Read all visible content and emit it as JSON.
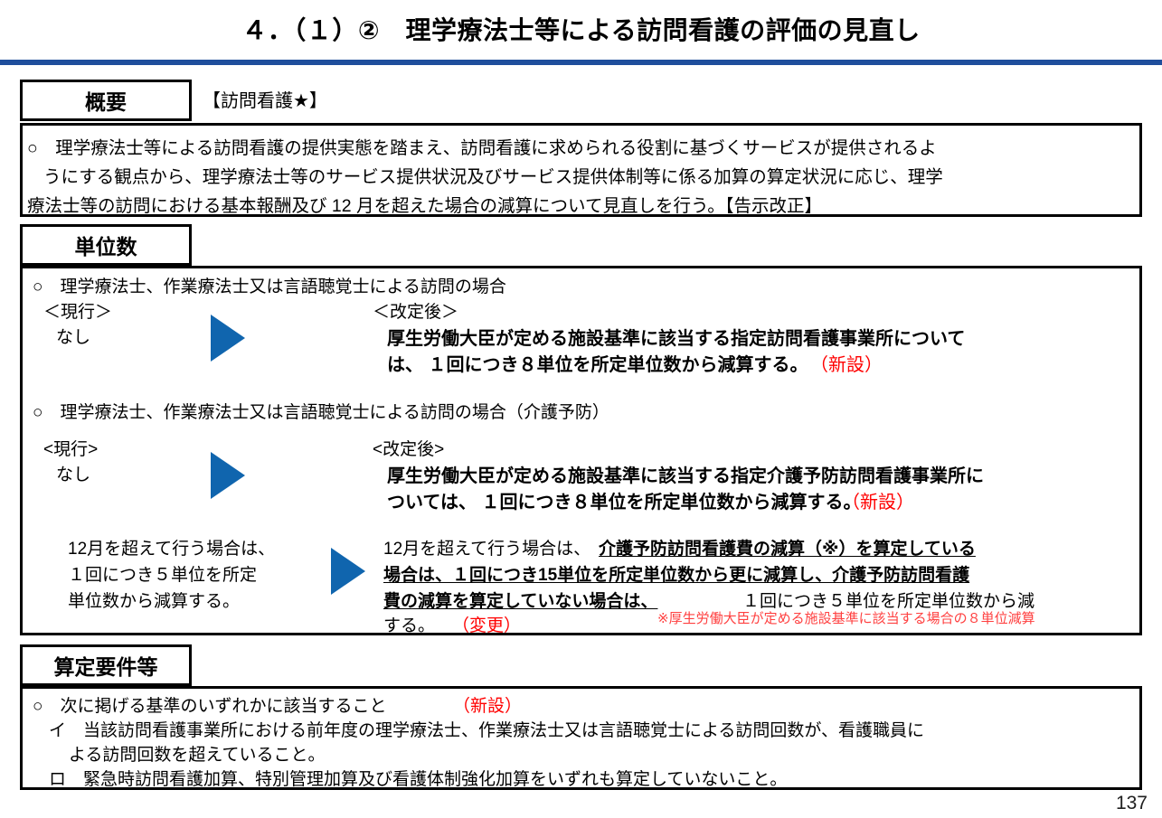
{
  "page": {
    "title": "４．（１）②　理学療法士等による訪問看護の評価の見直し",
    "page_number": "137",
    "accent_color": "#1F4E9C",
    "arrow_color": "#1065AE",
    "annotation_color": "#FF0000"
  },
  "sections": {
    "overview": {
      "tab_label": "概要",
      "header_label": "【訪問看護★】",
      "body_lines": [
        "○　理学療法士等による訪問看護の提供実態を踏まえ、訪問看護に求められる役割に基づくサービスが提供されるよ",
        "うにする観点から、理学療法士等のサービス提供状況及びサービス提供体制等に係る加算の算定状況に応じ、理学",
        "療法士等の訪問における基本報酬及び 12 月を超えた場合の減算について見直しを行う。【告示改正】"
      ]
    },
    "units": {
      "tab_label": "単位数",
      "block1": {
        "heading": "○　理学療法士、作業療法士又は言語聴覚士による訪問の場合",
        "current_label": "＜現行＞",
        "current_value": "なし",
        "revised_label": "＜改定後＞",
        "revised_line1": "厚生労働大臣が定める施設基準に該当する指定訪問看護事業所について",
        "revised_line2": "は、 １回につき８単位を所定単位数から減算する。",
        "revised_tag": "（新設）"
      },
      "block2": {
        "heading": "○　理学療法士、作業療法士又は言語聴覚士による訪問の場合（介護予防）",
        "current_label": "<現行>",
        "current_value": "なし",
        "revised_label": "<改定後>",
        "revised_line1": "厚生労働大臣が定める施設基準に該当する指定介護予防訪問看護事業所に",
        "revised_line2": "ついては、 １回につき８単位を所定単位数から減算する。",
        "revised_tag": "（新設）"
      },
      "block3": {
        "current_line1": "12月を超えて行う場合は、",
        "current_line2": "１回につき５単位を所定",
        "current_line3": "単位数から減算する。",
        "revised_prefix": "12月を超えて行う場合は、",
        "revised_bold1": "介護予防訪問看護費の減算（※）を算定している",
        "revised_bold2": "場合は、１回につき15単位を所定単位数から更に減算し、介護予防訪問看護",
        "revised_bold3": "費の減算を算定していない場合は、",
        "revised_tail1": "１回につき５単位を所定単位数から減",
        "revised_tail2": "する。",
        "revised_tag": "（変更）",
        "footnote": "※厚生労働大臣が定める施設基準に該当する場合の８単位減算"
      }
    },
    "requirements": {
      "tab_label": "算定要件等",
      "line1_text": "○　次に掲げる基準のいずれかに該当すること",
      "line1_tag": "（新設）",
      "line2a": "イ　当該訪問看護事業所における前年度の理学療法士、作業療法士又は言語聴覚士による訪問回数が、看護職員に",
      "line2b": "よる訪問回数を超えていること。",
      "line3": "ロ　緊急時訪問看護加算、特別管理加算及び看護体制強化加算をいずれも算定していないこと。"
    }
  }
}
